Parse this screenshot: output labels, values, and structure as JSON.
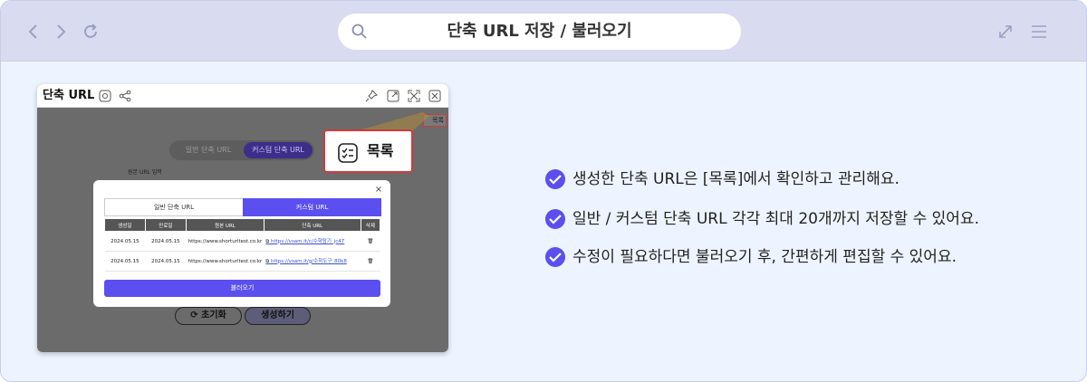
{
  "browser": {
    "title": "단축 URL 저장 / 불러오기"
  },
  "app": {
    "title": "단축 URL",
    "list_mini": "목록",
    "segment": {
      "general": "일반 단축 URL",
      "custom": "커스텀 단축 URL"
    },
    "field_label": "원본 URL 입력",
    "reset_label": "초기화",
    "generate_label": "생성하기"
  },
  "modal": {
    "tabs": {
      "general": "일반 단축 URL",
      "custom": "커스텀 URL"
    },
    "columns": [
      "생성일",
      "만료일",
      "원본 URL",
      "단축 URL",
      "삭제"
    ],
    "rows": [
      {
        "created": "2024.05.15",
        "expires": "2024.05.15",
        "original": "https://www.shorturltest.co.kr",
        "short": "https://vsam.it/c/수학탐기_jc47"
      },
      {
        "created": "2024.05.15",
        "expires": "2024.05.15",
        "original": "https://www.shorturltest.co.kr",
        "short": "https://vsam.it/g/수학도구_80k8"
      }
    ],
    "load_label": "불러오기",
    "close_label": "×"
  },
  "callout": {
    "label": "목록"
  },
  "features": [
    "생성한 단축 URL은 [목록]에서 확인하고 관리해요.",
    "일반 / 커스텀 단축 URL 각각 최대 20개까지 저장할 수 있어요.",
    "수정이 필요하다면 불러오기 후, 간편하게 편집할 수 있어요."
  ],
  "colors": {
    "accent": "#5b4ff0",
    "callout_border": "#d23a3a",
    "topbar": "#d9dcf0",
    "page_bg": "#eef4ff"
  }
}
